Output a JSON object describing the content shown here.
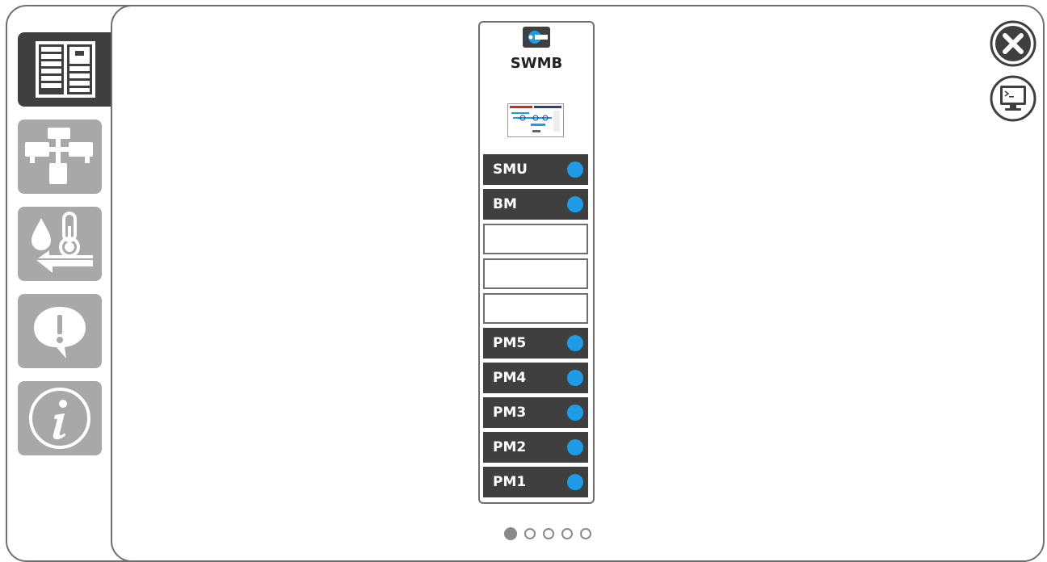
{
  "sidebar": {
    "items": [
      {
        "id": "rack-view",
        "icon": "rack-cabinet-icon",
        "active": true
      },
      {
        "id": "network-view",
        "icon": "network-topology-icon",
        "active": false
      },
      {
        "id": "environment-view",
        "icon": "water-temperature-icon",
        "active": false
      },
      {
        "id": "alarms-view",
        "icon": "alert-bubble-icon",
        "active": false
      },
      {
        "id": "info-view",
        "icon": "info-icon",
        "active": false
      }
    ]
  },
  "toolbar": {
    "close_icon": "close-icon",
    "terminal_icon": "terminal-monitor-icon"
  },
  "rack": {
    "title": "SWMB",
    "logo_icon": "swmb-logo-icon",
    "slots": [
      {
        "label": "SMU",
        "filled": true,
        "status_color": "#1e9be6"
      },
      {
        "label": "BM",
        "filled": true,
        "status_color": "#1e9be6"
      },
      {
        "label": "",
        "filled": false
      },
      {
        "label": "",
        "filled": false
      },
      {
        "label": "",
        "filled": false
      },
      {
        "label": "PM5",
        "filled": true,
        "status_color": "#1e9be6"
      },
      {
        "label": "PM4",
        "filled": true,
        "status_color": "#1e9be6"
      },
      {
        "label": "PM3",
        "filled": true,
        "status_color": "#1e9be6"
      },
      {
        "label": "PM2",
        "filled": true,
        "status_color": "#1e9be6"
      },
      {
        "label": "PM1",
        "filled": true,
        "status_color": "#1e9be6"
      }
    ]
  },
  "pager": {
    "pages": 5,
    "current": 1
  },
  "colors": {
    "accent": "#1e9be6",
    "dark": "#3f3f3f",
    "inactive": "#a8a8a8",
    "border": "#6f6f6f"
  }
}
